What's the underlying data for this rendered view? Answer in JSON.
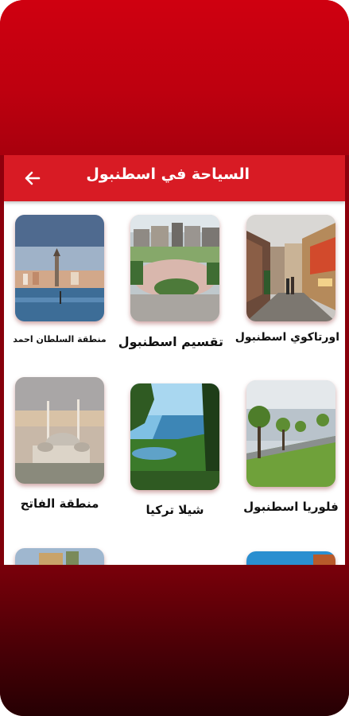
{
  "header": {
    "title": "السياحة في اسطنبول"
  },
  "places": [
    {
      "name": "اورتاكوي اسطنبول"
    },
    {
      "name": "تقسيم اسطنبول"
    },
    {
      "name": "منطقة السلطان احمد"
    },
    {
      "name": "فلوريا اسطنبول"
    },
    {
      "name": "شيلا تركيا"
    },
    {
      "name": "منطقة الفاتح"
    }
  ],
  "colors": {
    "app_bar": "#d81b24",
    "frame_top": "#c8000c",
    "frame_bottom": "#260003"
  },
  "icons": {
    "back": "arrow-left-icon"
  }
}
